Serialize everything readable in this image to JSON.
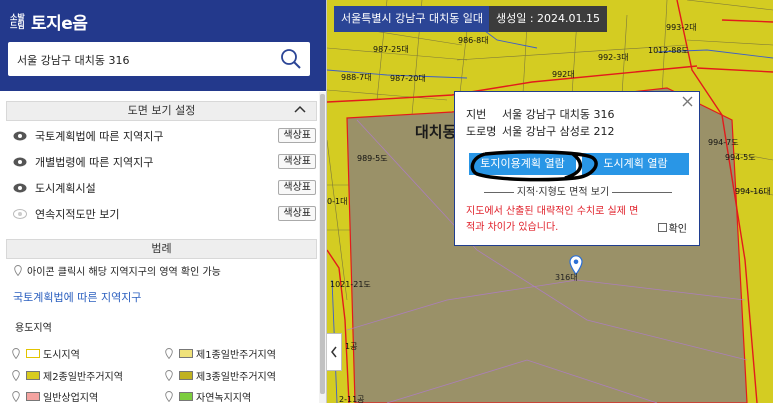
{
  "logo": {
    "small": "소발 드림",
    "name": "토지e음"
  },
  "search": {
    "value": "서울 강남구 대치동 316"
  },
  "view_settings": {
    "title": "도면 보기 설정",
    "layers": [
      {
        "label": "국토계획법에 따른 지역지구",
        "button": "색상표"
      },
      {
        "label": "개별법령에 따른 지역지구",
        "button": "색상표"
      },
      {
        "label": "도시계획시설",
        "button": "색상표"
      },
      {
        "label": "연속지적도만 보기",
        "button": "색상표"
      }
    ]
  },
  "legend": {
    "title": "범례",
    "hint": "아이콘 클릭시 해당 지역지구의 영역 확인 가능",
    "section": "국토계획법에 따른 지역지구",
    "subsection": "용도지역",
    "items": [
      {
        "label": "도시지역",
        "color": "#ffffff",
        "border": "#e2c400"
      },
      {
        "label": "제1종일반주거지역",
        "color": "#f0e27a"
      },
      {
        "label": "제2종일반주거지역",
        "color": "#d9cc1f"
      },
      {
        "label": "제3종일반주거지역",
        "color": "#c0b221"
      },
      {
        "label": "일반상업지역",
        "color": "#f4a3a0"
      },
      {
        "label": "자연녹지지역",
        "color": "#7ccd3e"
      }
    ]
  },
  "map": {
    "address_chip": "서울특별시 강남구 대치동 일대",
    "date_chip": "생성일 : 2024.01.15",
    "district_label": "대치동",
    "parcel_labels": [
      "993-2대",
      "987-25대",
      "986-8대",
      "1012-88도",
      "988-7대",
      "987-20대",
      "992대",
      "992-3대",
      "994-7도",
      "994-5도",
      "994-16대",
      "989-5도",
      "0-1대",
      "1021-21도",
      "316대",
      "1공",
      "2-11공"
    ],
    "colors": {
      "zone": "#d4cc22",
      "parcel": "#9a9168",
      "boundary": "#e21b1b"
    }
  },
  "popup": {
    "jibun_key": "지번",
    "jibun_value": "서울 강남구 대치동 316",
    "road_key": "도로명",
    "road_value": "서울 강남구 삼성로 212",
    "btn_land": "토지이용계획 열람",
    "btn_city": "도시계획 열람",
    "area_view": "지적·지형도 면적 보기",
    "warning": "지도에서 산출된 대략적인 수치로 실제 면적과 차이가 있습니다.",
    "confirm": "확인"
  }
}
